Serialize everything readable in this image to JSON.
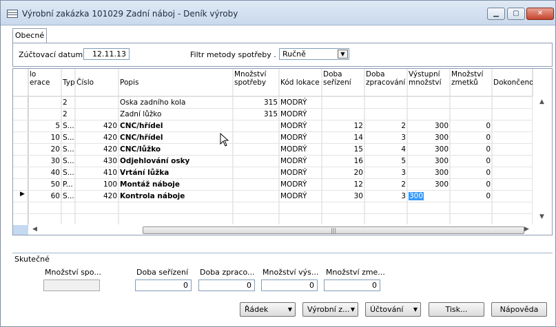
{
  "window": {
    "title": "Výrobní zakázka 101029 Zadní náboj - Deník výroby"
  },
  "tabs": [
    {
      "label": "Obecné"
    }
  ],
  "filters": {
    "posting_date_label": "Zúčtovací datum  .",
    "posting_date_value": "12.11.13",
    "flushing_filter_label": "Filtr metody spotřeby .  .",
    "flushing_filter_value": "Ručně"
  },
  "grid": {
    "headers": {
      "op_no_line1": "lo",
      "op_no_line2": "erace",
      "type": "Typ",
      "no": "Číslo",
      "description": "Popis",
      "consumption_qty_line1": "Množství",
      "consumption_qty_line2": "spotřeby",
      "location": "Kód lokace",
      "setup_time_line1": "Doba",
      "setup_time_line2": "seřízení",
      "run_time_line1": "Doba",
      "run_time_line2": "zpracování",
      "output_qty_line1": "Výstupní",
      "output_qty_line2": "množství",
      "scrap_qty_line1": "Množství",
      "scrap_qty_line2": "zmetků",
      "finished": "Dokončeno"
    },
    "rows": [
      {
        "op": "",
        "type": "2",
        "no": "",
        "desc": "Oska zadního kola",
        "cons": "315",
        "loc": "MODRÝ",
        "setup": "",
        "run": "",
        "out": "",
        "scrap": "",
        "bold": false,
        "current": false
      },
      {
        "op": "",
        "type": "2",
        "no": "",
        "desc": "Zadní lůžko",
        "cons": "315",
        "loc": "MODRÝ",
        "setup": "",
        "run": "",
        "out": "",
        "scrap": "",
        "bold": false,
        "current": false
      },
      {
        "op": "5",
        "type": "S...",
        "no": "420",
        "desc": "CNC/hřídel",
        "cons": "",
        "loc": "MODRÝ",
        "setup": "12",
        "run": "2",
        "out": "300",
        "scrap": "0",
        "bold": true,
        "current": false
      },
      {
        "op": "10",
        "type": "S...",
        "no": "420",
        "desc": "CNC/hřídel",
        "cons": "",
        "loc": "MODRÝ",
        "setup": "14",
        "run": "3",
        "out": "300",
        "scrap": "0",
        "bold": true,
        "current": false
      },
      {
        "op": "20",
        "type": "S...",
        "no": "420",
        "desc": "CNC/lůžko",
        "cons": "",
        "loc": "MODRÝ",
        "setup": "15",
        "run": "4",
        "out": "300",
        "scrap": "0",
        "bold": true,
        "current": false
      },
      {
        "op": "30",
        "type": "S...",
        "no": "430",
        "desc": "Odjehlování osky",
        "cons": "",
        "loc": "MODRÝ",
        "setup": "16",
        "run": "5",
        "out": "300",
        "scrap": "0",
        "bold": true,
        "current": false
      },
      {
        "op": "40",
        "type": "S...",
        "no": "410",
        "desc": "Vrtání lůžka",
        "cons": "",
        "loc": "MODRÝ",
        "setup": "20",
        "run": "3",
        "out": "300",
        "scrap": "0",
        "bold": true,
        "current": false
      },
      {
        "op": "50",
        "type": "P...",
        "no": "100",
        "desc": "Montáž náboje",
        "cons": "",
        "loc": "MODRÝ",
        "setup": "12",
        "run": "2",
        "out": "300",
        "scrap": "0",
        "bold": true,
        "current": false
      },
      {
        "op": "60",
        "type": "S...",
        "no": "420",
        "desc": "Kontrola náboje",
        "cons": "",
        "loc": "MODRÝ",
        "setup": "30",
        "run": "3",
        "out": "300",
        "scrap": "0",
        "bold": true,
        "current": true
      }
    ]
  },
  "actual": {
    "group_label": "Skutečné",
    "consumption_qty_label": "Množství spo...",
    "consumption_qty_value": "",
    "setup_time_label": "Doba seřízení",
    "setup_time_value": "0",
    "run_time_label": "Doba zpraco...",
    "run_time_value": "0",
    "output_qty_label": "Množství výs...",
    "output_qty_value": "0",
    "scrap_qty_label": "Množství zme...",
    "scrap_qty_value": "0"
  },
  "buttons": {
    "line": "Řádek",
    "production": "Výrobní z...",
    "posting": "Účtování",
    "print": "Tisk...",
    "help": "Nápověda"
  },
  "colors": {
    "selected_value_bg": "#3399ff",
    "selector_header_bg": "#c5d9f1"
  }
}
